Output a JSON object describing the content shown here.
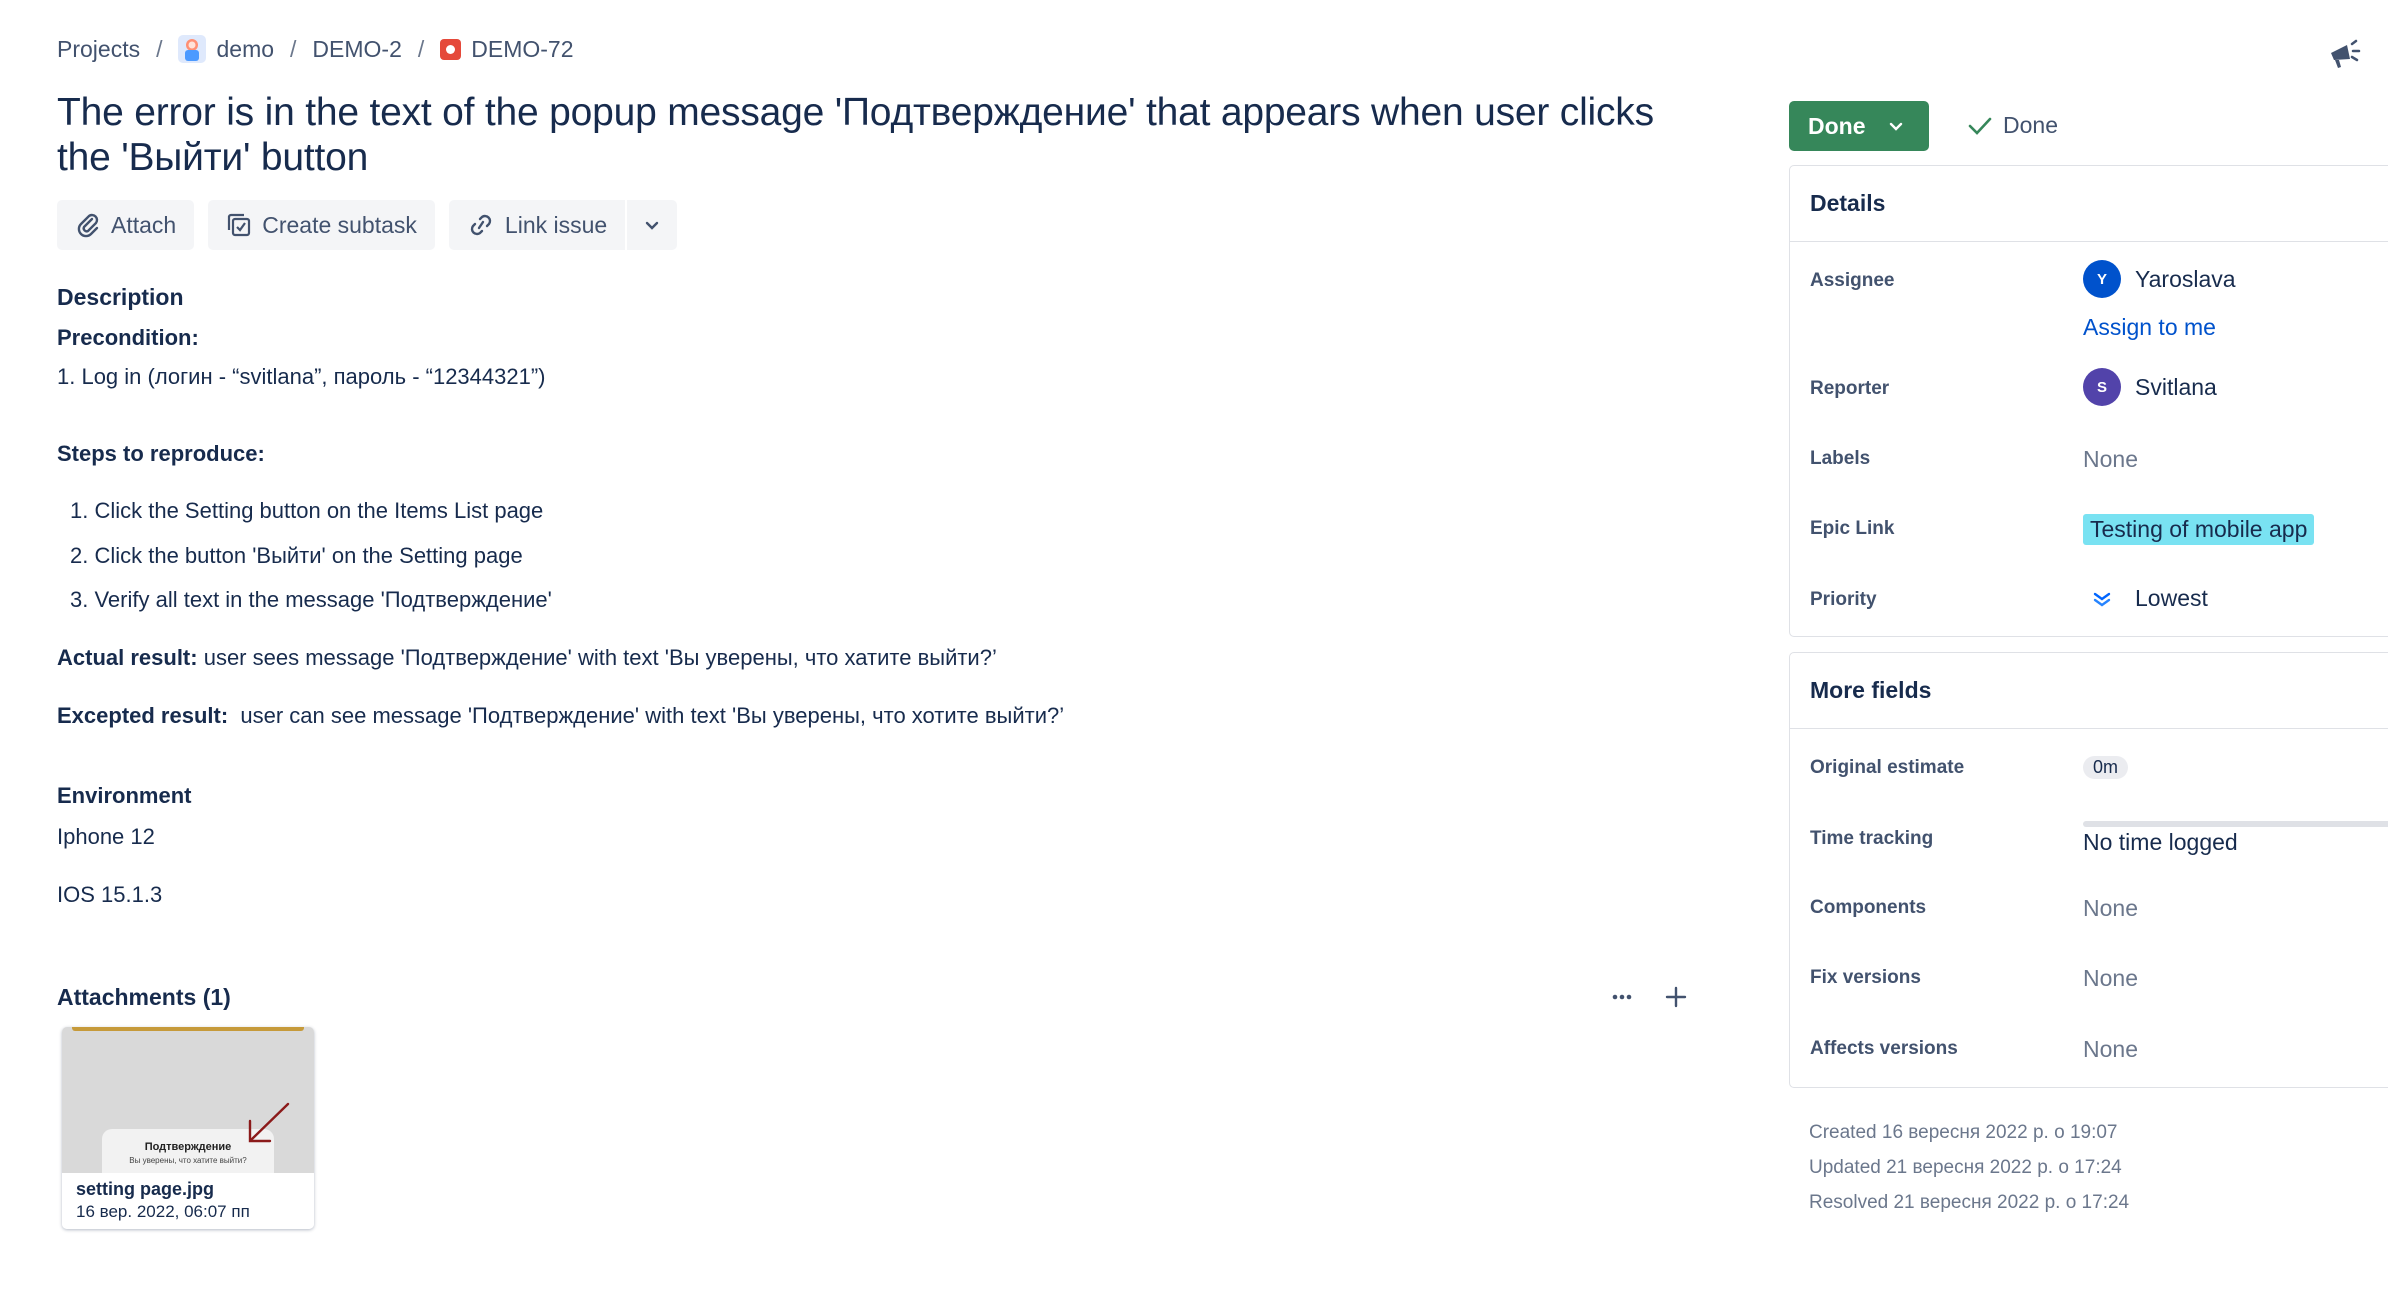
{
  "breadcrumb": {
    "projects": "Projects",
    "project": "demo",
    "parent": "DEMO-2",
    "issue_key": "DEMO-72",
    "separator": "/"
  },
  "issue": {
    "title": "The error is in the text of the popup message 'Подтверждение' that appears when user clicks the 'Выйти' button"
  },
  "toolbar": {
    "attach": "Attach",
    "create_subtask": "Create subtask",
    "link_issue": "Link issue"
  },
  "description": {
    "heading": "Description",
    "precondition_label": "Precondition:",
    "precondition_text": "1. Log in (логин - “svitlana”, пароль - “12344321”)",
    "steps_label": "Steps to reproduce:",
    "steps": [
      "1. Click the Setting button on the Items List page",
      "2. Click the button 'Выйти' on the Setting page",
      "3. Verify all text in the message 'Подтверждение'"
    ],
    "actual_label": "Actual result:",
    "actual_text": " user sees message 'Подтверждение' with text 'Вы уверены, что хатите выйти?’",
    "expected_label": "Excepted result:",
    "expected_text": "  user can see message 'Подтверждение' with text 'Вы уверены, что хотите выйти?’",
    "environment_label": "Environment",
    "environment_lines": [
      "Iphone 12",
      "IOS 15.1.3"
    ]
  },
  "attachments": {
    "header": "Attachments (1)",
    "items": [
      {
        "name": "setting page.jpg",
        "date": "16 вер. 2022, 06:07 пп",
        "thumb_title": "Подтверждение",
        "thumb_text": "Вы уверены, что хатите выйти?"
      }
    ]
  },
  "status": {
    "button": "Done",
    "resolution": "Done",
    "color": "#36875a"
  },
  "details": {
    "header": "Details",
    "assignee_label": "Assignee",
    "assignee_name": "Yaroslava",
    "assignee_initial": "Y",
    "assign_to_me": "Assign to me",
    "reporter_label": "Reporter",
    "reporter_name": "Svitlana",
    "reporter_initial": "S",
    "labels_label": "Labels",
    "labels_value": "None",
    "epic_label": "Epic Link",
    "epic_value": "Testing of mobile app",
    "priority_label": "Priority",
    "priority_value": "Lowest"
  },
  "more_fields": {
    "header": "More fields",
    "original_estimate_label": "Original estimate",
    "original_estimate_value": "0m",
    "time_tracking_label": "Time tracking",
    "time_tracking_value": "No time logged",
    "components_label": "Components",
    "components_value": "None",
    "fix_versions_label": "Fix versions",
    "fix_versions_value": "None",
    "affects_versions_label": "Affects versions",
    "affects_versions_value": "None"
  },
  "timestamps": {
    "created": "Created 16 вересня 2022 р. о 19:07",
    "updated": "Updated 21 вересня 2022 р. о 17:24",
    "resolved": "Resolved 21 вересня 2022 р. о 17:24"
  }
}
